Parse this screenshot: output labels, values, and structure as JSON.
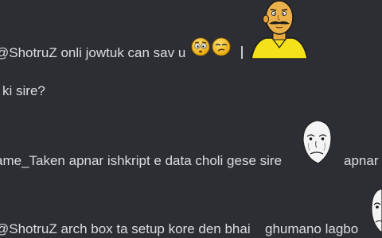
{
  "chat": {
    "messages": [
      {
        "text": "@ShotruZ onli jowtuk can sav u"
      },
      {
        "text": "ki sire?"
      },
      {
        "text": "ame_Taken apnar ishkript e data choli gese sire",
        "tail": "apnar"
      },
      {
        "text": "@ShotruZ arch box ta setup kore den bhai",
        "tail": "ghumano lagbo"
      }
    ]
  },
  "emojis": {
    "line1_a": "worried-face-emoji",
    "line1_b": "confused-face-emoji",
    "line1_big": "mustache-man-emoji",
    "line3_big": "sad-okay-face-emoji",
    "line4_big": "sad-okay-face-emoji"
  },
  "colors": {
    "background": "#2d2e33",
    "text": "#dcdde1",
    "emoji_yellow": "#f5c518"
  }
}
